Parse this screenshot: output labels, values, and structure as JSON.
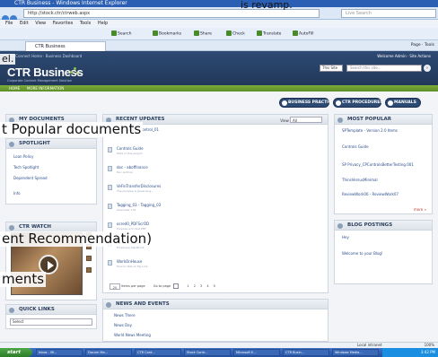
{
  "window": {
    "title": "CTR Business - Windows Internet Explorer"
  },
  "browser": {
    "url": "http://stock.ctr/ctrweb.aspx",
    "search_placeholder": "Live Search",
    "menu": [
      "File",
      "Edit",
      "View",
      "Favorites",
      "Tools",
      "Help"
    ],
    "toolbar": [
      "Search",
      "Bookmarks",
      "Share",
      "Check",
      "Translate",
      "AutoFill"
    ],
    "tab_label": "CTR Business",
    "tab_tools": "Page · Tools"
  },
  "header": {
    "crumbs": "CTR Connect Home · Business Dashboard",
    "logo": "CTR Business",
    "tagline": "Corporate Content Management Solution",
    "welcome": "Welcome Admin · Site Actions",
    "scope": "This Site",
    "search_placeholder": "Search this site..."
  },
  "green_nav": [
    "HOME",
    "MORE INFORMATION"
  ],
  "buttons": [
    "BUSINESS PRACTICES",
    "CTR PROCEDURES",
    "MANUALS"
  ],
  "left": {
    "my_documents": "MY DOCUMENTS",
    "spotlight": "SPOTLIGHT",
    "spotlight_items": [
      "Loan Policy",
      "Tech Spotlight",
      "Dependent Spread",
      "Info"
    ],
    "ctr_watch": "CTR WATCH",
    "quick_links": "QUICK LINKS",
    "quick_select": "Select"
  },
  "center": {
    "recent": "RECENT UPDATES",
    "view_label": "View",
    "view_select": "All",
    "items": [
      {
        "title": "Control_01 - Control_01",
        "sub": "Overview: 11"
      },
      {
        "title": "Controls Guide",
        "sub": "Data in this project"
      },
      {
        "title": "doc - aboffinance",
        "sub": "Doc archive"
      },
      {
        "title": "VeFinTransferDisclosures",
        "sub": "The purpose is governing..."
      },
      {
        "title": "Tagging_03 - Tagging_03",
        "sub": "Overview: 131"
      },
      {
        "title": "ocred0_PDFScrOD",
        "sub": "Purpose is to test PDF"
      },
      {
        "title": "Handbook123",
        "sub": "Employee handbook"
      },
      {
        "title": "WorkOnHouse",
        "sub": "How to Test on My Link"
      }
    ],
    "pager": {
      "rows": "20",
      "label": "items per page",
      "goto": "Go to page",
      "pages": "1  2  3  4  5"
    },
    "news": "NEWS AND EVENTS",
    "news_items": [
      "News There",
      "News Day",
      "World News Meeting"
    ]
  },
  "right": {
    "most_popular": "MOST POPULAR",
    "popular_items": [
      "SPTemplate - Version 2.0 Items",
      "Controls Guide",
      "SP Privacy_CPControlsBetterTesting.001",
      "ThinsVersusMinimal",
      "ReviewWork06 - ReviewWork07"
    ],
    "more": "more »",
    "blog": "BLOG POSTINGS",
    "blog_items": [
      "Hey",
      "Welcome to your Blog!"
    ]
  },
  "overlay": {
    "line1": "is revamp.",
    "line2": "el.",
    "line3": "t Popular documents",
    "line4": "ent Recommendation)",
    "line5": "ments"
  },
  "status": {
    "left": "Local intranet",
    "zoom": "100%"
  },
  "taskbar": {
    "start": "start",
    "buttons": [
      "Inbox - Mi...",
      "Docum Ma...",
      "CTR Cont...",
      "Stock Contr...",
      "Microsoft E...",
      "CTR Busin...",
      "Windows Media..."
    ],
    "time": "3:42 PM"
  }
}
